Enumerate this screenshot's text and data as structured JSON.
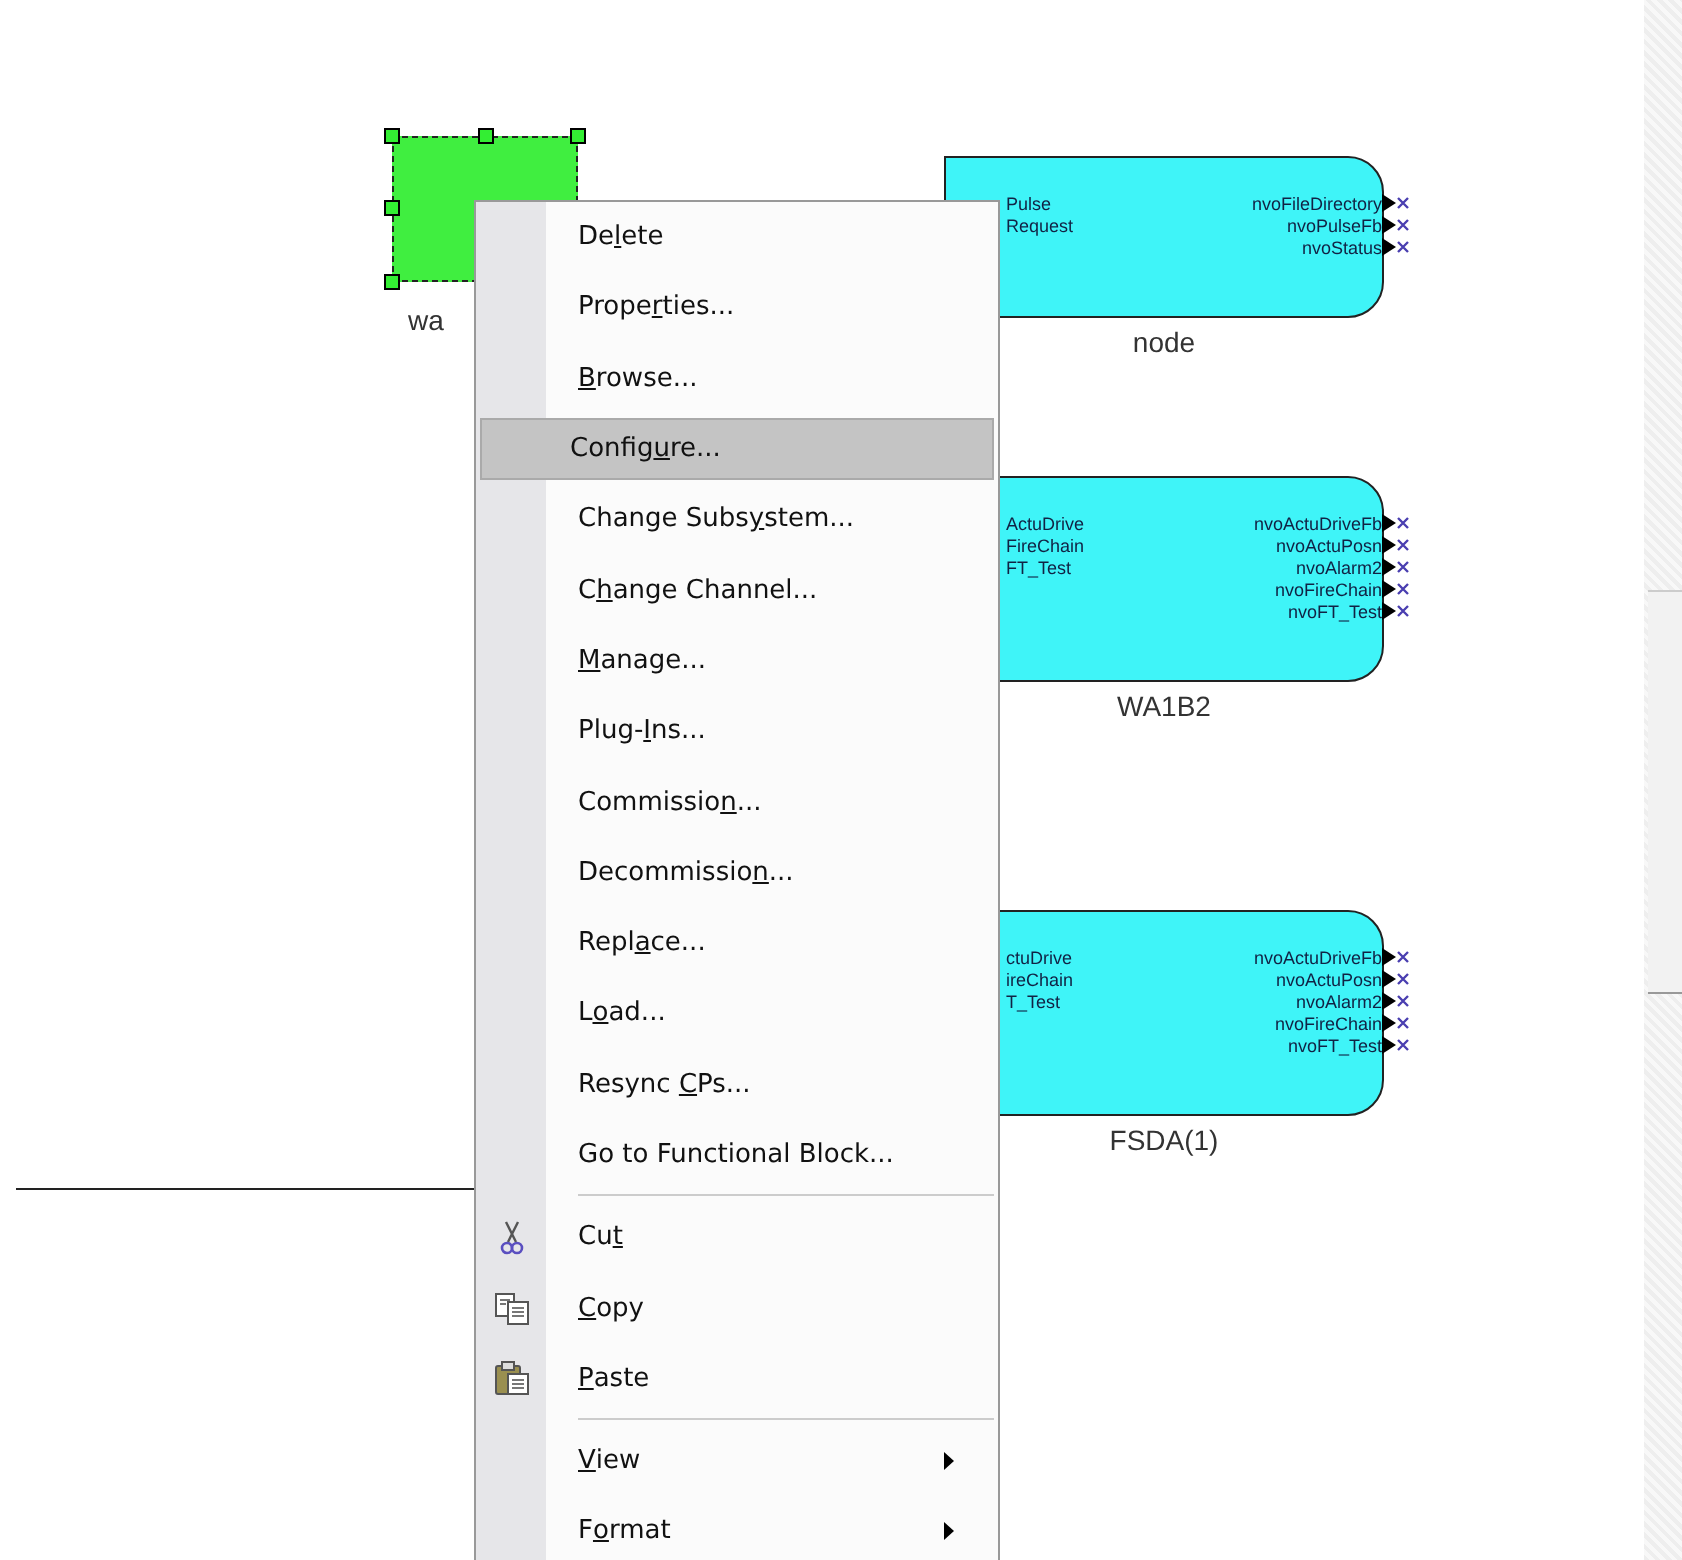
{
  "canvas": {
    "selected_block": {
      "label": "wa",
      "selected": true
    },
    "nodes": [
      {
        "name": "node",
        "inputs": [
          "Pulse",
          "Request"
        ],
        "outputs": [
          "nvoFileDirectory",
          "nvoPulseFb",
          "nvoStatus"
        ]
      },
      {
        "name": "WA1B2",
        "inputs": [
          "ActuDrive",
          "FireChain",
          "FT_Test"
        ],
        "outputs": [
          "nvoActuDriveFb",
          "nvoActuPosn",
          "nvoAlarm2",
          "nvoFireChain",
          "nvoFT_Test"
        ]
      },
      {
        "name": "FSDA(1)",
        "inputs": [
          "ctuDrive",
          "ireChain",
          "T_Test"
        ],
        "outputs": [
          "nvoActuDriveFb",
          "nvoActuPosn",
          "nvoAlarm2",
          "nvoFireChain",
          "nvoFT_Test"
        ]
      }
    ]
  },
  "context_menu": {
    "items": [
      {
        "kind": "item",
        "pre": "De",
        "key": "l",
        "post": "ete",
        "selected": false
      },
      {
        "kind": "item",
        "pre": "Prope",
        "key": "r",
        "post": "ties...",
        "selected": false
      },
      {
        "kind": "item",
        "key": "B",
        "post": "rowse...",
        "selected": false
      },
      {
        "kind": "item",
        "pre": "Config",
        "key": "u",
        "post": "re...",
        "selected": true
      },
      {
        "kind": "item",
        "pre": "Change Subs",
        "key": "y",
        "post": "stem...",
        "selected": false
      },
      {
        "kind": "item",
        "pre": "C",
        "key": "h",
        "post": "ange Channel...",
        "selected": false
      },
      {
        "kind": "item",
        "key": "M",
        "post": "anage...",
        "selected": false
      },
      {
        "kind": "item",
        "pre": "Plug-",
        "key": "I",
        "post": "ns...",
        "selected": false
      },
      {
        "kind": "item",
        "pre": "Commissio",
        "key": "n",
        "post": "...",
        "selected": false
      },
      {
        "kind": "item",
        "pre": "Decommissio",
        "key": "n",
        "post": "...",
        "selected": false
      },
      {
        "kind": "item",
        "pre": "Repl",
        "key": "a",
        "post": "ce...",
        "selected": false
      },
      {
        "kind": "item",
        "pre": "L",
        "key": "o",
        "post": "ad...",
        "selected": false
      },
      {
        "kind": "item",
        "pre": "Resync ",
        "key": "C",
        "post": "Ps...",
        "selected": false
      },
      {
        "kind": "item",
        "pre": "Go to Functional Block...",
        "selected": false
      },
      {
        "kind": "separator"
      },
      {
        "kind": "cut",
        "pre": "Cu",
        "key": "t",
        "selected": false
      },
      {
        "kind": "copy",
        "key": "C",
        "post": "opy",
        "selected": false
      },
      {
        "kind": "paste",
        "key": "P",
        "post": "aste",
        "selected": false
      },
      {
        "kind": "separator"
      },
      {
        "kind": "submenu",
        "key": "V",
        "post": "iew",
        "selected": false
      },
      {
        "kind": "submenu",
        "pre": "F",
        "key": "o",
        "post": "rmat",
        "selected": false
      }
    ]
  }
}
